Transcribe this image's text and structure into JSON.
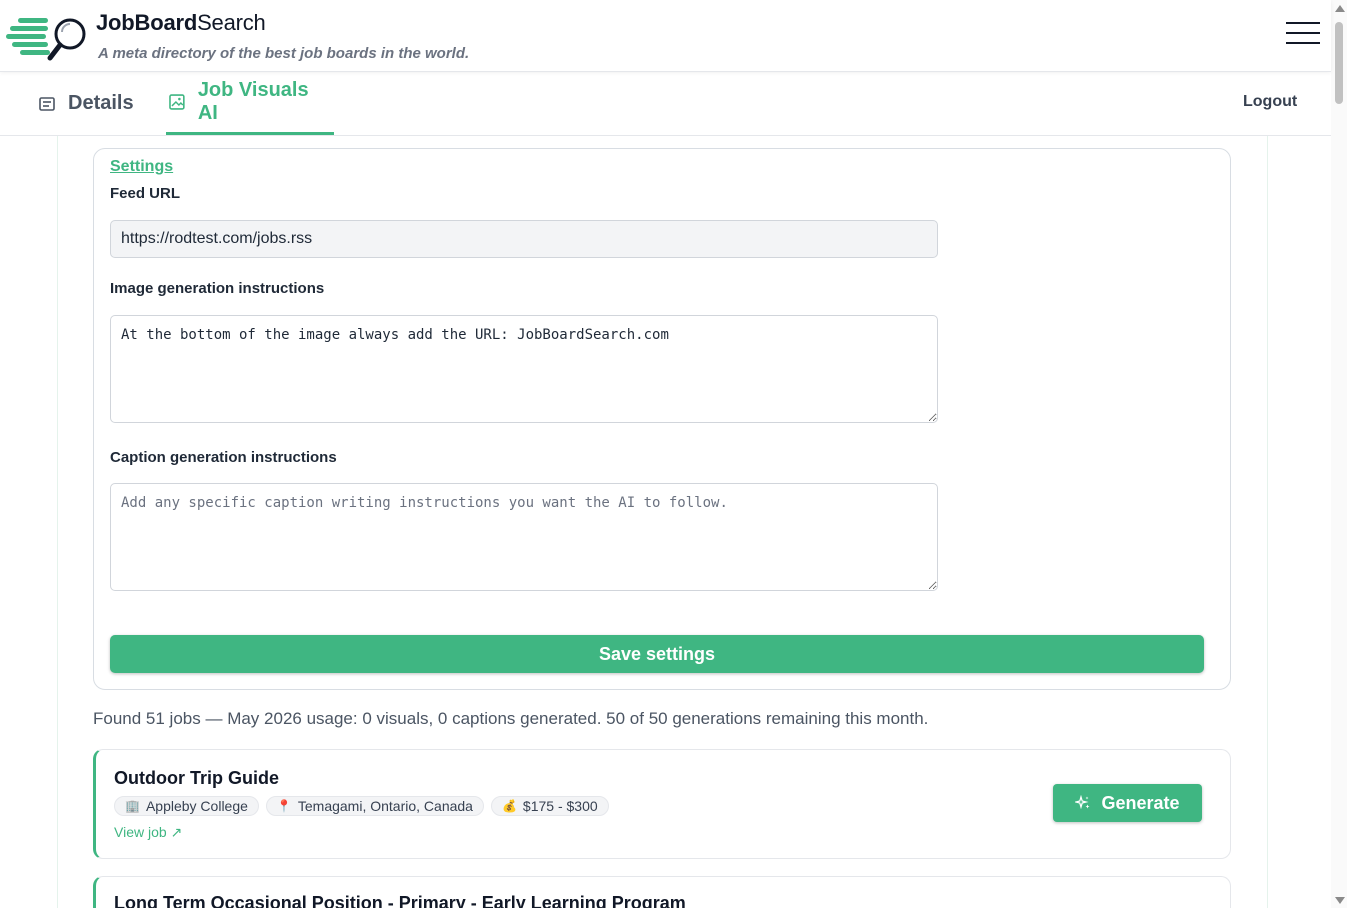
{
  "header": {
    "brand_bold": "JobBoard",
    "brand_light": "Search",
    "tagline": "A meta directory of the best job boards in the world.",
    "logo_icon": "magnifier-speed-icon",
    "menu_icon": "hamburger-menu-icon"
  },
  "tabs": [
    {
      "label": "Details",
      "icon": "document-icon",
      "active": false
    },
    {
      "label": "Job Visuals AI",
      "icon": "image-icon",
      "active": true
    }
  ],
  "logout_label": "Logout",
  "settings": {
    "link_label": "Settings",
    "feed_url_label": "Feed URL",
    "feed_url_value": "https://rodtest.com/jobs.rss",
    "image_instructions_label": "Image generation instructions",
    "image_instructions_value": "At the bottom of the image always add the URL: JobBoardSearch.com",
    "caption_instructions_label": "Caption generation instructions",
    "caption_instructions_placeholder": "Add any specific caption writing instructions you want the AI to follow.",
    "save_label": "Save settings"
  },
  "summary": "Found 51 jobs — May 2026 usage: 0 visuals, 0 captions generated. 50 of 50 generations remaining this month.",
  "jobs": [
    {
      "title": "Outdoor Trip Guide",
      "company": "Appleby College",
      "company_icon": "🏢",
      "location": "Temagami, Ontario, Canada",
      "location_icon": "📍",
      "salary": "$175 - $300",
      "salary_icon": "💰",
      "view_label": "View job ↗",
      "generate_label": "Generate"
    },
    {
      "title": "Long Term Occasional Position - Primary - Early Learning Program"
    }
  ],
  "colors": {
    "accent": "#3fb682",
    "text": "#1f2937",
    "muted": "#6b7280"
  }
}
